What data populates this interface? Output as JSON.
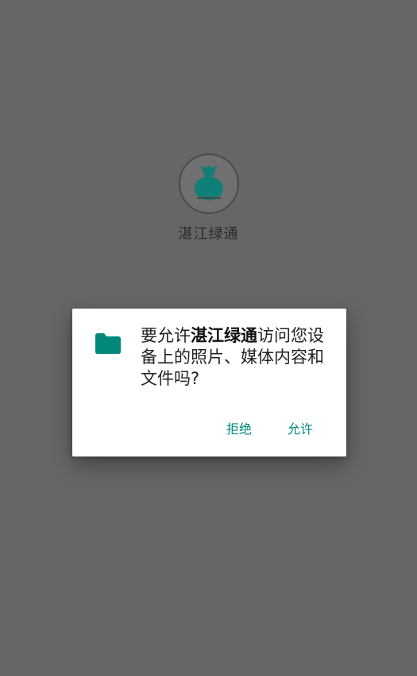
{
  "splash": {
    "app_name": "湛江绿通"
  },
  "dialog": {
    "message_prefix": "要允许",
    "message_app": "湛江绿通",
    "message_suffix": "访问您设备上的照片、媒体内容和文件吗?",
    "deny_label": "拒绝",
    "allow_label": "允许",
    "icon": "folder-icon"
  },
  "colors": {
    "accent": "#00897b",
    "scrim": "#666666",
    "dialog_bg": "#ffffff"
  }
}
